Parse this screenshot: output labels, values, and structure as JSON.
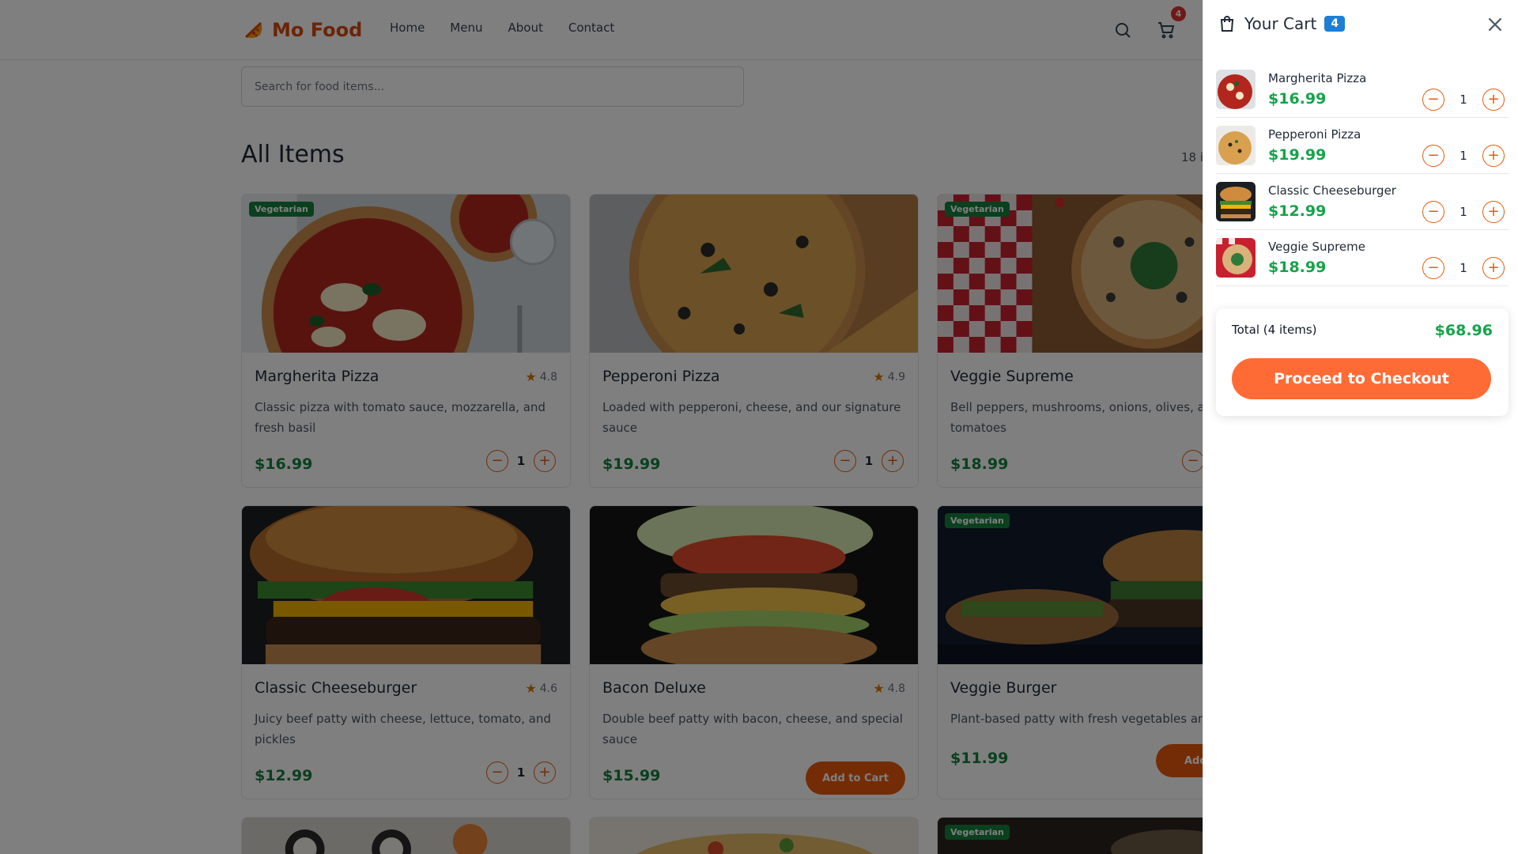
{
  "brand": {
    "name": "Mo Food",
    "accent": "#d9480f"
  },
  "nav": [
    "Home",
    "Menu",
    "About",
    "Contact"
  ],
  "header": {
    "cart_badge": "4"
  },
  "search": {
    "placeholder": "Search for food items..."
  },
  "section": {
    "title": "All Items",
    "count": "18 i"
  },
  "items": [
    {
      "name": "Margherita Pizza",
      "rating": "4.8",
      "desc": "Classic pizza with tomato sauce, mozzarella, and fresh basil",
      "price": "$16.99",
      "qty": "1",
      "badge": "Vegetarian"
    },
    {
      "name": "Pepperoni Pizza",
      "rating": "4.9",
      "desc": "Loaded with pepperoni, cheese, and our signature sauce",
      "price": "$19.99",
      "qty": "1",
      "badge": ""
    },
    {
      "name": "Veggie Supreme",
      "rating": "",
      "desc": "Bell peppers, mushrooms, onions, olives, and tomatoes",
      "price": "$18.99",
      "qty": "",
      "badge": "Vegetarian"
    },
    {
      "name": "Classic Cheeseburger",
      "rating": "4.6",
      "desc": "Juicy beef patty with cheese, lettuce, tomato, and pickles",
      "price": "$12.99",
      "qty": "1",
      "badge": ""
    },
    {
      "name": "Bacon Deluxe",
      "rating": "4.8",
      "desc": "Double beef patty with bacon, cheese, and special sauce",
      "price": "$15.99",
      "add": "Add to Cart",
      "badge": ""
    },
    {
      "name": "Veggie Burger",
      "rating": "",
      "desc": "Plant-based patty with fresh vegetables and a",
      "price": "$11.99",
      "add": "Add t",
      "badge": "Vegetarian"
    },
    {
      "badge": "Vegetarian"
    }
  ],
  "cart": {
    "title": "Your Cart",
    "count": "4",
    "items": [
      {
        "name": "Margherita Pizza",
        "price": "$16.99",
        "qty": "1"
      },
      {
        "name": "Pepperoni Pizza",
        "price": "$19.99",
        "qty": "1"
      },
      {
        "name": "Classic Cheeseburger",
        "price": "$12.99",
        "qty": "1"
      },
      {
        "name": "Veggie Supreme",
        "price": "$18.99",
        "qty": "1"
      }
    ],
    "total_label": "Total (4 items)",
    "total_value": "$68.96",
    "checkout_label": "Proceed to Checkout"
  },
  "icons": {
    "logo": "pizza-slice-icon",
    "search": "search-icon",
    "cart": "cart-icon",
    "panel": "shopping-bag-icon",
    "close": "close-icon",
    "rating": "star-icon",
    "minus": "minus-icon",
    "plus": "plus-icon"
  }
}
